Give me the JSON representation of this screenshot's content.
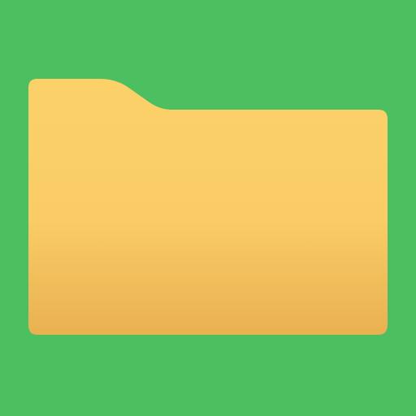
{
  "icon": {
    "name": "folder-icon",
    "colors": {
      "background": "#4cbf60",
      "folder_top": "#fcd168",
      "folder_mid": "#f9cc67",
      "folder_bottom": "#eab151"
    }
  }
}
